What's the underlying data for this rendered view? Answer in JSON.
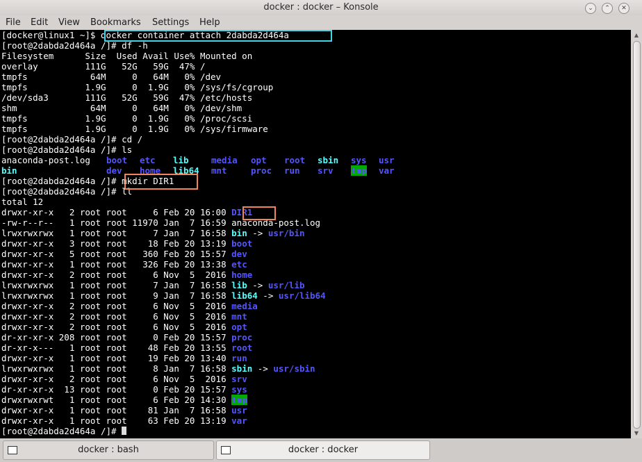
{
  "window": {
    "title": "docker : docker – Konsole"
  },
  "menu": [
    "File",
    "Edit",
    "View",
    "Bookmarks",
    "Settings",
    "Help"
  ],
  "terminal": {
    "l01": {
      "prompt": "[docker@linux1 ~]$ ",
      "cmd": "docker container attach 2dabda2d464a"
    },
    "l02": "[root@2dabda2d464a /]# df -h",
    "l03": "Filesystem      Size  Used Avail Use% Mounted on",
    "l04": "overlay         111G   52G   59G  47% /",
    "l05": "tmpfs            64M     0   64M   0% /dev",
    "l06": "tmpfs           1.9G     0  1.9G   0% /sys/fs/cgroup",
    "l07": "/dev/sda3       111G   52G   59G  47% /etc/hosts",
    "l08": "shm              64M     0   64M   0% /dev/shm",
    "l09": "tmpfs           1.9G     0  1.9G   0% /proc/scsi",
    "l10": "tmpfs           1.9G     0  1.9G   0% /sys/firmware",
    "l11": "[root@2dabda2d464a /]# cd /",
    "l12": "[root@2dabda2d464a /]# ls",
    "ls1": {
      "a": "anaconda-post.log",
      "boot": "boot",
      "etc": "etc",
      "lib": "lib",
      "media": "media",
      "opt": "opt",
      "root": "root",
      "sbin": "sbin",
      "sys": "sys",
      "usr": "usr"
    },
    "ls2": {
      "bin": "bin",
      "dev": "dev",
      "home": "home",
      "lib64": "lib64",
      "mnt": "mnt",
      "proc": "proc",
      "run": "run",
      "srv": "srv",
      "tmp": "tmp",
      "var": "var"
    },
    "l15": {
      "prompt": "[root@2dabda2d464a /]# ",
      "cmd": "mkdir DIR1"
    },
    "l16": "[root@2dabda2d464a /]# ll",
    "l17": "total 12",
    "ll": [
      {
        "meta": "drwxr-xr-x   2 root root     6 Feb 20 16:00 ",
        "name": "DIR1",
        "target": ""
      },
      {
        "meta": "-rw-r--r--   1 root root 11970 Jan  7 16:59 ",
        "name": "anaconda-post.log",
        "target": ""
      },
      {
        "meta": "lrwxrwxrwx   1 root root     7 Jan  7 16:58 ",
        "name": "bin",
        "target": "usr/bin"
      },
      {
        "meta": "drwxr-xr-x   3 root root    18 Feb 20 13:19 ",
        "name": "boot",
        "target": ""
      },
      {
        "meta": "drwxr-xr-x   5 root root   360 Feb 20 15:57 ",
        "name": "dev",
        "target": ""
      },
      {
        "meta": "drwxr-xr-x   1 root root   326 Feb 20 13:38 ",
        "name": "etc",
        "target": ""
      },
      {
        "meta": "drwxr-xr-x   2 root root     6 Nov  5  2016 ",
        "name": "home",
        "target": ""
      },
      {
        "meta": "lrwxrwxrwx   1 root root     7 Jan  7 16:58 ",
        "name": "lib",
        "target": "usr/lib"
      },
      {
        "meta": "lrwxrwxrwx   1 root root     9 Jan  7 16:58 ",
        "name": "lib64",
        "target": "usr/lib64"
      },
      {
        "meta": "drwxr-xr-x   2 root root     6 Nov  5  2016 ",
        "name": "media",
        "target": ""
      },
      {
        "meta": "drwxr-xr-x   2 root root     6 Nov  5  2016 ",
        "name": "mnt",
        "target": ""
      },
      {
        "meta": "drwxr-xr-x   2 root root     6 Nov  5  2016 ",
        "name": "opt",
        "target": ""
      },
      {
        "meta": "dr-xr-xr-x 208 root root     0 Feb 20 15:57 ",
        "name": "proc",
        "target": ""
      },
      {
        "meta": "dr-xr-x---   1 root root    48 Feb 20 13:55 ",
        "name": "root",
        "target": ""
      },
      {
        "meta": "drwxr-xr-x   1 root root    19 Feb 20 13:40 ",
        "name": "run",
        "target": ""
      },
      {
        "meta": "lrwxrwxrwx   1 root root     8 Jan  7 16:58 ",
        "name": "sbin",
        "target": "usr/sbin"
      },
      {
        "meta": "drwxr-xr-x   2 root root     6 Nov  5  2016 ",
        "name": "srv",
        "target": ""
      },
      {
        "meta": "dr-xr-xr-x  13 root root     0 Feb 20 15:57 ",
        "name": "sys",
        "target": ""
      },
      {
        "meta": "drwxrwxrwt   1 root root     6 Feb 20 14:30 ",
        "name": "tmp",
        "target": ""
      },
      {
        "meta": "drwxr-xr-x   1 root root    81 Jan  7 16:58 ",
        "name": "usr",
        "target": ""
      },
      {
        "meta": "drwxr-xr-x   1 root root    63 Feb 20 13:19 ",
        "name": "var",
        "target": ""
      }
    ],
    "arrow": " -> ",
    "final_prompt": "[root@2dabda2d464a /]# "
  },
  "tabs": [
    {
      "label": "docker : bash"
    },
    {
      "label": "docker : docker"
    }
  ],
  "colors": {
    "dir": "#5555ff",
    "symlink": "#55ffff",
    "tmp_bg": "#00aa00",
    "highlight_cyan": "#43d4ea",
    "highlight_orange": "#f0845a"
  }
}
